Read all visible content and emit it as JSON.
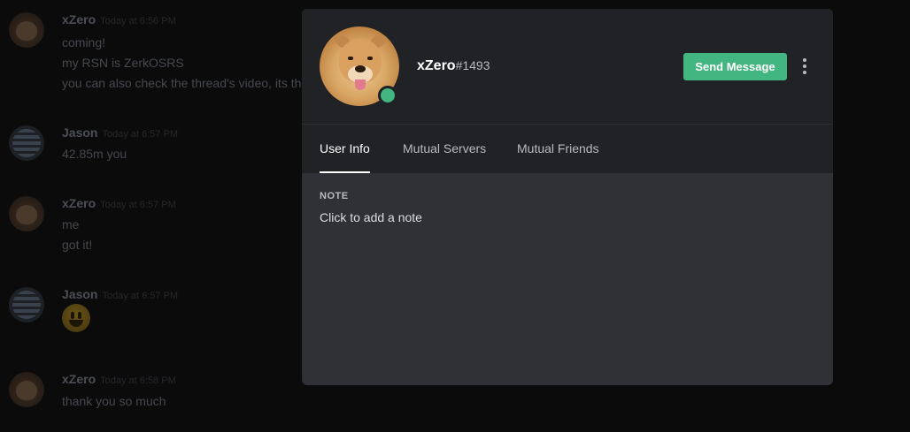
{
  "chat": {
    "messages": [
      {
        "author": "xZero",
        "time": "Today at 6:56 PM",
        "avatar": "shiba-avatar",
        "lines": [
          "coming!",
          "my RSN is ZerkOSRS",
          "you can also check the thread's video, its the"
        ]
      },
      {
        "author": "Jason",
        "time": "Today at 6:57 PM",
        "avatar": "runescape-avatar",
        "lines": [
          "42.85m you"
        ]
      },
      {
        "author": "xZero",
        "time": "Today at 6:57 PM",
        "avatar": "shiba-avatar",
        "lines": [
          "me",
          "got it!"
        ]
      },
      {
        "author": "Jason",
        "time": "Today at 6:57 PM",
        "avatar": "runescape-avatar",
        "lines": [],
        "emoji": "smiley-emoji"
      },
      {
        "author": "xZero",
        "time": "Today at 6:58 PM",
        "avatar": "shiba-avatar",
        "lines": [
          "thank you so much"
        ]
      }
    ]
  },
  "profile": {
    "username": "xZero",
    "discriminator": "#1493",
    "status": "online",
    "status_color": "#43b581",
    "send_message_label": "Send Message",
    "more_icon": "more-vertical-icon",
    "tabs": [
      {
        "label": "User Info",
        "active": true
      },
      {
        "label": "Mutual Servers",
        "active": false
      },
      {
        "label": "Mutual Friends",
        "active": false
      }
    ],
    "note": {
      "title": "NOTE",
      "placeholder": "Click to add a note"
    }
  },
  "colors": {
    "accent_green": "#43b581",
    "modal_header_bg": "#202225",
    "modal_body_bg": "#2f3136",
    "backdrop": "#0b0b0c"
  }
}
